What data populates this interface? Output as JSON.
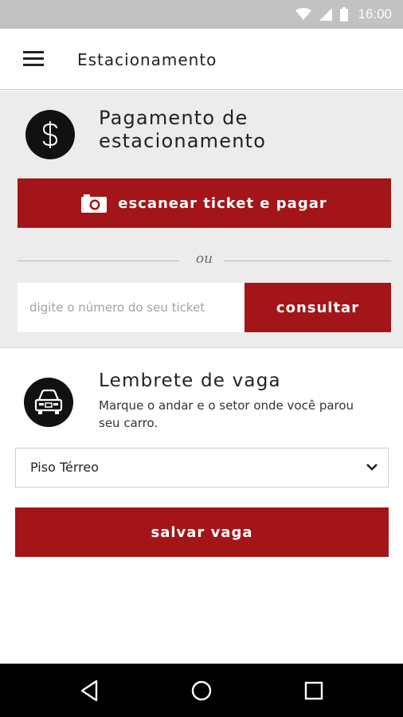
{
  "status_bar": {
    "time": "16:00",
    "icons": [
      "wifi-icon",
      "signal-icon",
      "battery-icon"
    ]
  },
  "app_bar": {
    "title": "Estacionamento",
    "menu_icon": "menu-icon"
  },
  "payment": {
    "icon": "dollar-icon",
    "title": "Pagamento de estacionamento",
    "scan_button_icon": "camera-icon",
    "scan_button_label": "escanear ticket e pagar",
    "or_label": "ou",
    "ticket_input": {
      "value": "",
      "placeholder": "digite o número do seu ticket"
    },
    "consult_button_label": "consultar"
  },
  "reminder": {
    "icon": "car-icon",
    "title": "Lembrete de vaga",
    "description": "Marque o andar e o setor onde você parou seu carro.",
    "floor_select": {
      "selected": "Piso Térreo"
    },
    "save_button_label": "salvar vaga"
  },
  "nav_bar": {
    "icons": [
      "back-icon",
      "home-icon",
      "recents-icon"
    ]
  },
  "colors": {
    "accent": "#a31518",
    "status_bar": "#c2c2c2",
    "section_bg": "#ececec",
    "nav_bar": "#000000"
  }
}
